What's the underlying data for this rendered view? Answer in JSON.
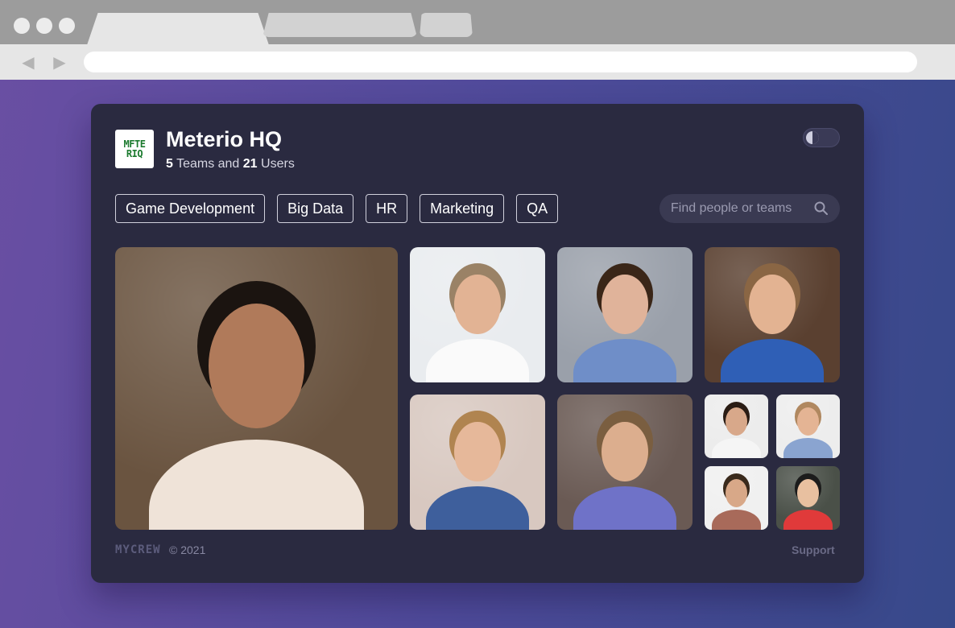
{
  "app": {
    "name": "Meterio HQ",
    "logo_text": [
      "MFTE",
      "RIQ"
    ],
    "teams_count": "5",
    "teams_label": "Teams and",
    "users_count": "21",
    "users_label": "Users"
  },
  "teams": [
    "Game Development",
    "Big Data",
    "HR",
    "Marketing",
    "QA"
  ],
  "search": {
    "placeholder": "Find people or teams"
  },
  "theme_toggle": {
    "state": "dark"
  },
  "people": [
    {
      "name": "woman-glasses-striped-shirt",
      "bg": "#6a5440",
      "skin": "#b07a5a",
      "shirt": "#efe3d8",
      "hair": "#1b1410"
    },
    {
      "name": "man-on-phone-white-shirt",
      "bg": "#e9ecef",
      "skin": "#e2b394",
      "shirt": "#fafafa",
      "hair": "#9a8266"
    },
    {
      "name": "man-curly-hair",
      "bg": "#9aa0aa",
      "skin": "#e0b39a",
      "shirt": "#6f8ec8",
      "hair": "#3a2618"
    },
    {
      "name": "man-blue-shirt",
      "bg": "#5a4030",
      "skin": "#e3b392",
      "shirt": "#2f5fb6",
      "hair": "#8a6644"
    },
    {
      "name": "woman-denim-shirt-measuring-tape",
      "bg": "#d8c8c0",
      "skin": "#e6b89a",
      "shirt": "#3e5f9c",
      "hair": "#b08450"
    },
    {
      "name": "man-glasses-headphones",
      "bg": "#6a5a54",
      "skin": "#dcae8e",
      "shirt": "#6f72c8",
      "hair": "#7a5e40"
    },
    {
      "name": "woman-glasses-white-top",
      "bg": "#ececec",
      "skin": "#d8a88a",
      "shirt": "#f5f5f5",
      "hair": "#2a1c14"
    },
    {
      "name": "woman-striped-sweater",
      "bg": "#ededed",
      "skin": "#e4b494",
      "shirt": "#8aa4d0",
      "hair": "#b08860"
    },
    {
      "name": "man-glasses-plaid-shirt",
      "bg": "#f0f0f0",
      "skin": "#d8a888",
      "shirt": "#a86a5a",
      "hair": "#3a2a1c"
    },
    {
      "name": "woman-red-top",
      "bg": "#4a5048",
      "skin": "#e8c0a0",
      "shirt": "#e03a3a",
      "hair": "#1c1c1c"
    }
  ],
  "footer": {
    "brand": "MYCREW",
    "copyright": "© 2021",
    "support": "Support"
  }
}
